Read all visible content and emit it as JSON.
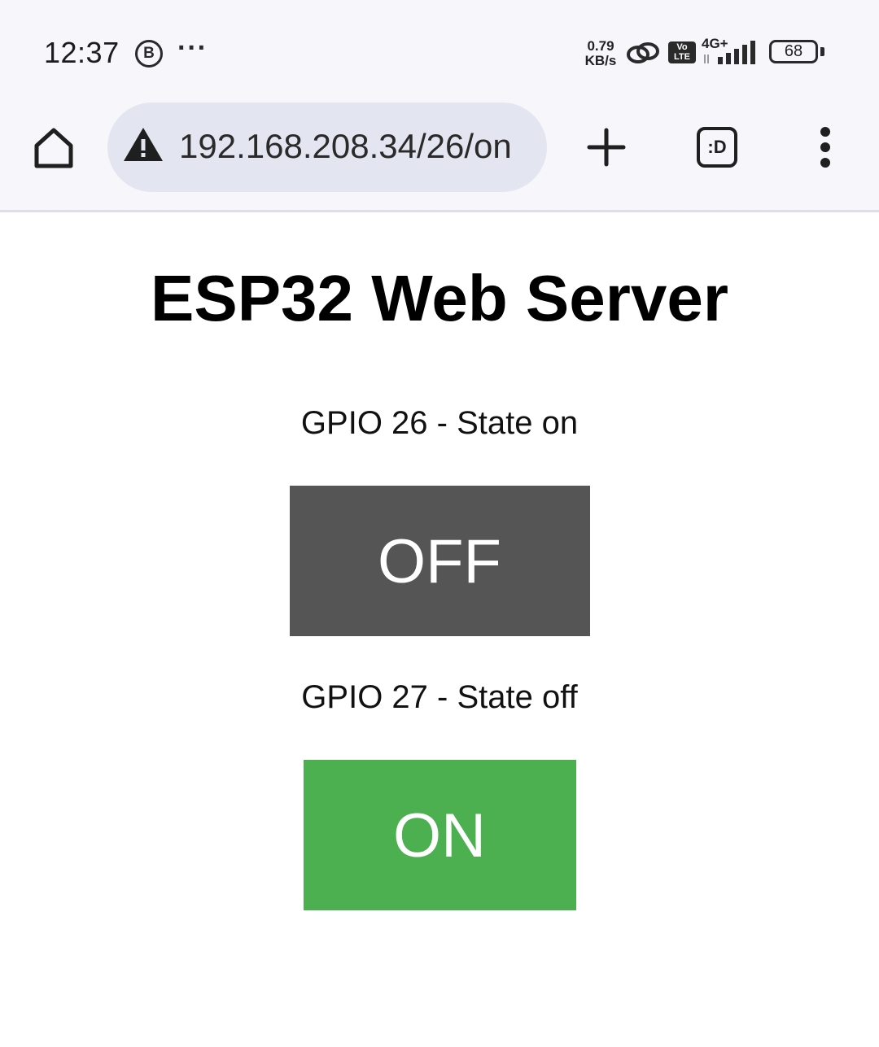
{
  "status_bar": {
    "time": "12:37",
    "b_badge": "B",
    "more_indicator": "···",
    "net_speed_value": "0.79",
    "net_speed_unit": "KB/s",
    "volte_line1": "Vo",
    "volte_line2": "LTE",
    "network_type": "4G+",
    "battery_level": "68",
    "icons": [
      "b-badge-icon",
      "more-dots-icon",
      "link-icon",
      "volte-icon",
      "signal-icon",
      "battery-icon"
    ]
  },
  "browser": {
    "url": "192.168.208.34/26/on",
    "tabs_label": ":D",
    "icons": [
      "home-icon",
      "not-secure-warning-icon",
      "plus-icon",
      "tab-switcher-icon",
      "kebab-menu-icon"
    ]
  },
  "page": {
    "title": "ESP32 Web Server",
    "gpios": [
      {
        "state_text": "GPIO 26 - State on",
        "button_label": "OFF",
        "button_color": "#555555"
      },
      {
        "state_text": "GPIO 27 - State off",
        "button_label": "ON",
        "button_color": "#4caf50"
      }
    ]
  },
  "colors": {
    "chrome_background": "#f6f6fb",
    "url_bar_background": "#e3e6f1",
    "off_button": "#555555",
    "on_button": "#4caf50"
  }
}
